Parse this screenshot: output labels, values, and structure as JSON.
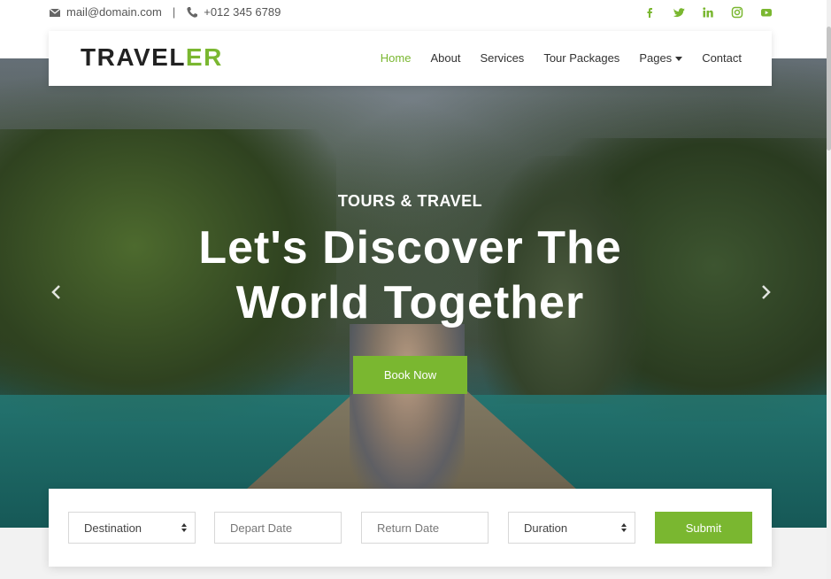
{
  "topbar": {
    "email": "mail@domain.com",
    "separator": "|",
    "phone": "+012 345 6789",
    "social_icons": [
      "facebook-icon",
      "twitter-icon",
      "linkedin-icon",
      "instagram-icon",
      "youtube-icon"
    ]
  },
  "brand": {
    "part1": "TRAVEL",
    "part2": "ER"
  },
  "nav": {
    "items": [
      {
        "label": "Home",
        "active": true
      },
      {
        "label": "About"
      },
      {
        "label": "Services"
      },
      {
        "label": "Tour Packages"
      },
      {
        "label": "Pages",
        "dropdown": true
      },
      {
        "label": "Contact"
      }
    ]
  },
  "hero": {
    "subtitle": "TOURS & TRAVEL",
    "title_line1": "Let's Discover The",
    "title_line2": "World Together",
    "cta": "Book Now",
    "prev_icon": "chevron-left-icon",
    "next_icon": "chevron-right-icon"
  },
  "booking": {
    "destination": "Destination",
    "depart_placeholder": "Depart Date",
    "return_placeholder": "Return Date",
    "duration": "Duration",
    "submit": "Submit"
  },
  "colors": {
    "accent": "#7ab730",
    "text_dark": "#222222"
  }
}
